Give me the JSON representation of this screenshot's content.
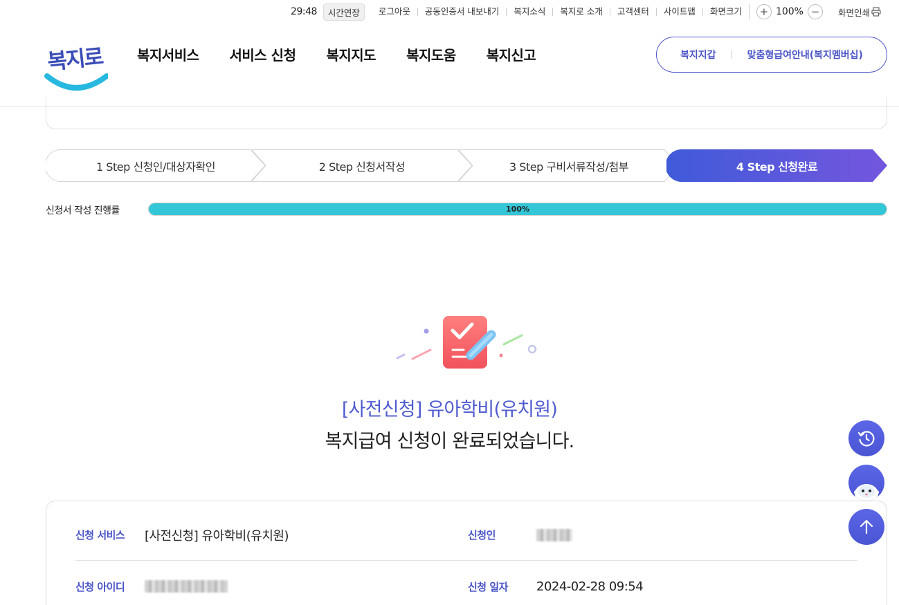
{
  "utility": {
    "timer": "29:48",
    "extend_label": "시간연장",
    "links": [
      "로그아웃",
      "공동인증서 내보내기",
      "복지소식",
      "복지로 소개",
      "고객센터",
      "사이트맵"
    ],
    "font_size_label": "화면크기",
    "zoom_value": "100%",
    "zoom_in": "+",
    "zoom_out": "−",
    "print_label": "화면인쇄"
  },
  "header": {
    "logo_text": "복지로",
    "nav": [
      "복지서비스",
      "서비스 신청",
      "복지지도",
      "복지도움",
      "복지신고"
    ],
    "quick_links": [
      "복지지갑",
      "맞춤형급여안내(복지멤버십)"
    ]
  },
  "steps": [
    {
      "label": "1 Step 신청인/대상자확인",
      "active": false
    },
    {
      "label": "2 Step 신청서작성",
      "active": false
    },
    {
      "label": "3 Step 구비서류작성/첨부",
      "active": false
    },
    {
      "label": "4 Step 신청완료",
      "active": true
    }
  ],
  "progress": {
    "label": "신청서 작성 진행률",
    "text": "100%",
    "value": 1.0
  },
  "completion": {
    "service": "[사전신청] 유아학비(유치원)",
    "message": "복지급여 신청이 완료되었습니다."
  },
  "summary": {
    "service_label": "신청 서비스",
    "service_value": "[사전신청] 유아학비(유치원)",
    "applicant_label": "신청인",
    "id_label": "신청 아이디",
    "date_label": "신청 일자",
    "date_value": "2024-02-28 09:54"
  },
  "floating": [
    "history-icon",
    "chatbot-icon",
    "arrow-up-icon"
  ],
  "colors": {
    "brand": "#4a55c7",
    "step_active_start": "#3f5bd9",
    "step_active_end": "#7456de",
    "progress": "#33c6d6"
  }
}
